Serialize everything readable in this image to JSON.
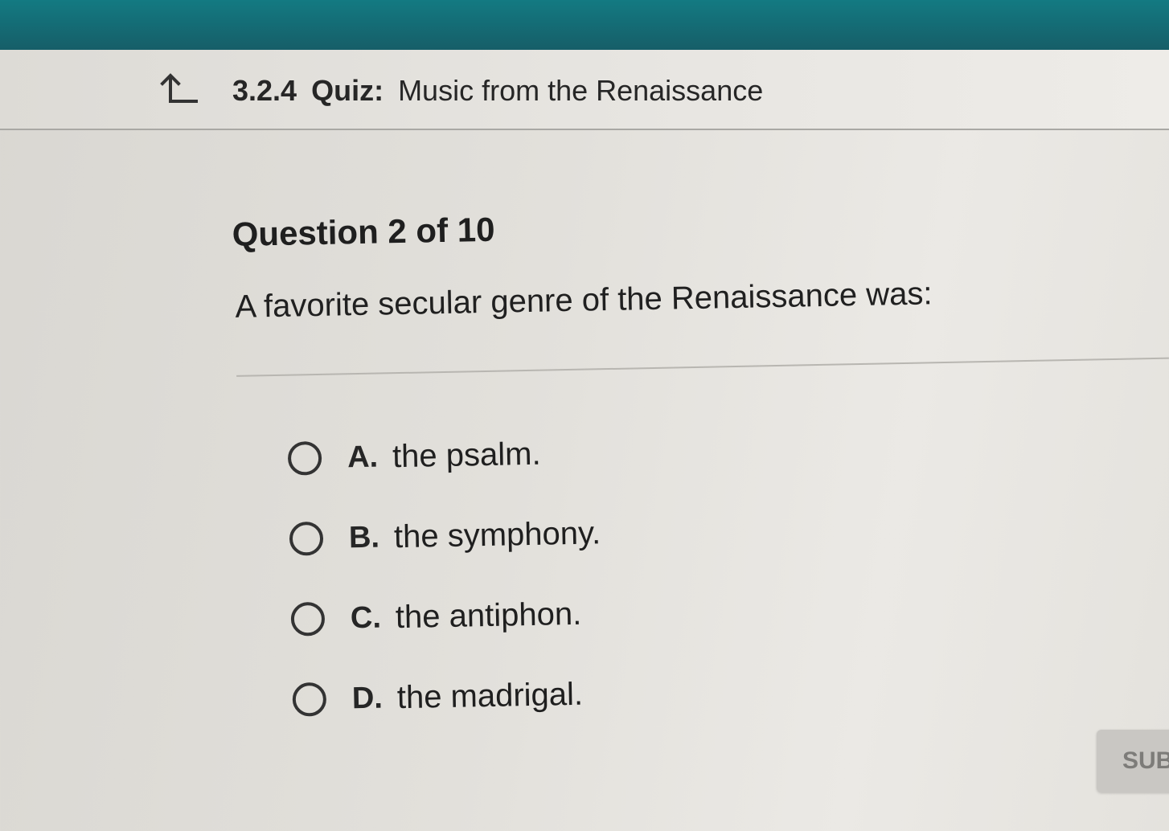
{
  "header": {
    "back_icon": "return-up-arrow-icon",
    "quiz_number": "3.2.4",
    "quiz_kind": "Quiz:",
    "quiz_title": "Music from the Renaissance"
  },
  "question": {
    "counter": "Question 2 of 10",
    "prompt": "A favorite secular genre of the Renaissance was:"
  },
  "options": [
    {
      "letter": "A.",
      "text": "the psalm."
    },
    {
      "letter": "B.",
      "text": "the symphony."
    },
    {
      "letter": "C.",
      "text": "the antiphon."
    },
    {
      "letter": "D.",
      "text": "the madrigal."
    }
  ],
  "submit_label": "SUB",
  "colors": {
    "top_band": "#137a82",
    "page_background": "#e2e0db",
    "text": "#222222"
  }
}
